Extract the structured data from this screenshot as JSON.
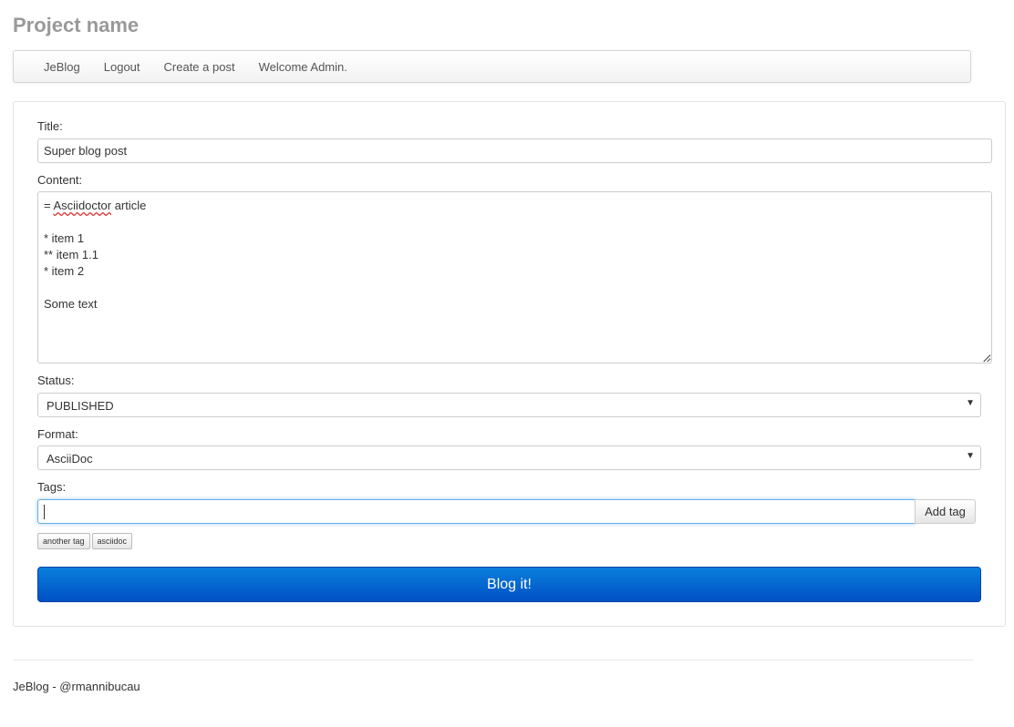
{
  "header": {
    "project_name": "Project name"
  },
  "nav": {
    "items": [
      {
        "label": "JeBlog"
      },
      {
        "label": "Logout"
      },
      {
        "label": "Create a post"
      },
      {
        "label": "Welcome Admin."
      }
    ]
  },
  "form": {
    "title": {
      "label": "Title:",
      "value": "Super blog post"
    },
    "content": {
      "label": "Content:",
      "lines": [
        {
          "prefix": "= ",
          "word": "Asciidoctor",
          "suffix": " article"
        },
        {
          "text": ""
        },
        {
          "text": "* item 1"
        },
        {
          "text": "** item 1.1"
        },
        {
          "text": "* item 2"
        },
        {
          "text": ""
        },
        {
          "text": "Some text"
        }
      ]
    },
    "status": {
      "label": "Status:",
      "selected": "PUBLISHED",
      "caret": "▼"
    },
    "format": {
      "label": "Format:",
      "selected": "AsciiDoc",
      "caret": "▼"
    },
    "tags": {
      "label": "Tags:",
      "input_value": "",
      "add_button_label": "Add tag",
      "items": [
        "another tag",
        "asciidoc"
      ]
    },
    "submit_label": "Blog it!"
  },
  "footer": {
    "text": "JeBlog - @rmannibucau"
  },
  "colors": {
    "primary_button": "#0050c4",
    "focus_border": "#66afe9",
    "project_name": "#999999"
  }
}
